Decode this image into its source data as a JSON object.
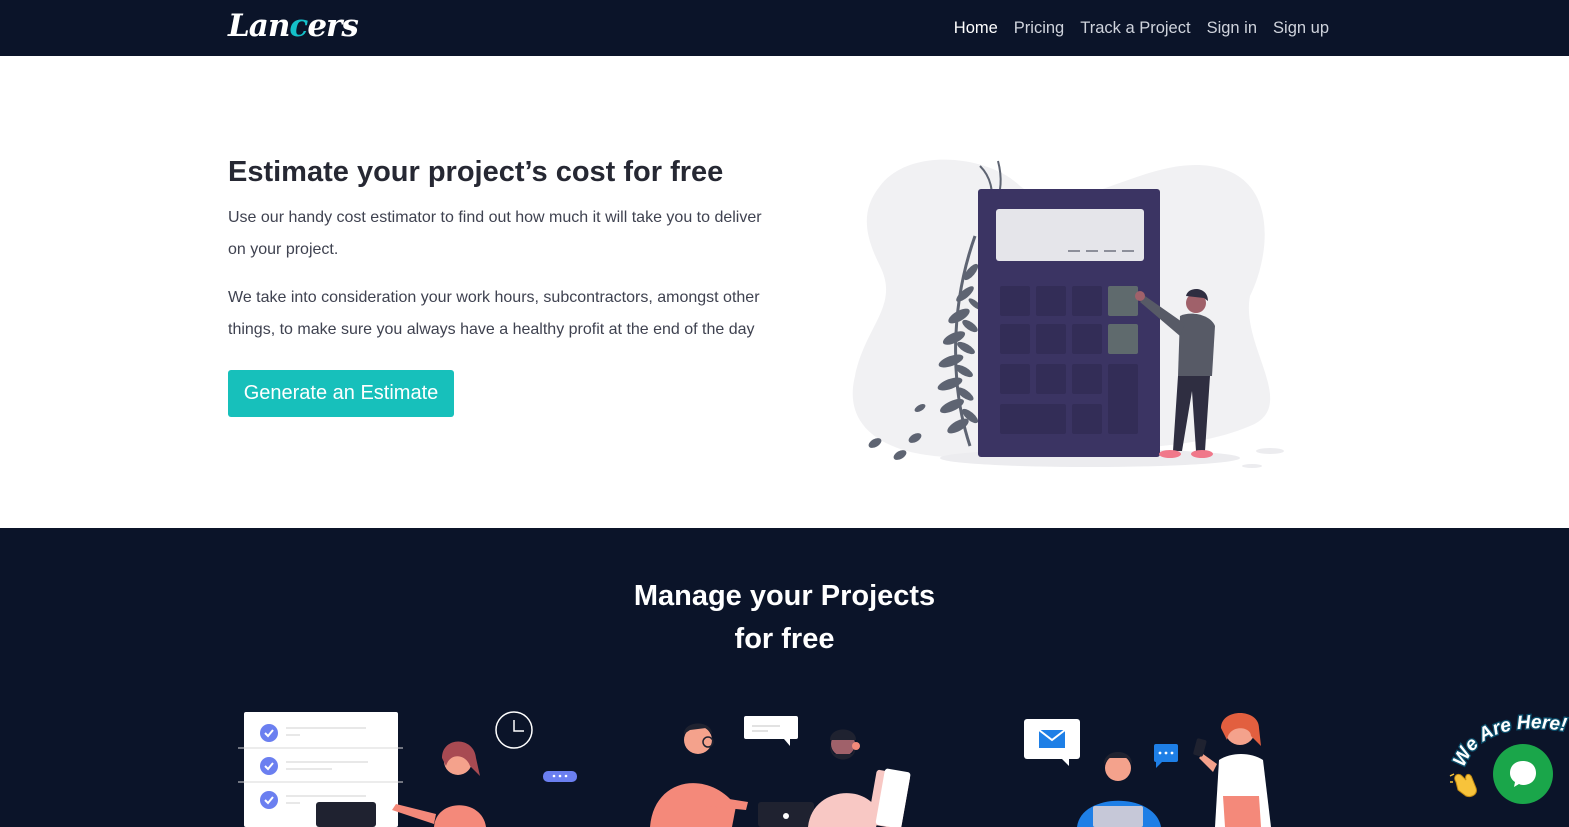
{
  "brand": {
    "logo_text_a": "Lan",
    "logo_text_b": "c",
    "logo_text_c": "ers"
  },
  "nav": {
    "items": [
      {
        "label": "Home",
        "active": true
      },
      {
        "label": "Pricing",
        "active": false
      },
      {
        "label": "Track a Project",
        "active": false
      },
      {
        "label": "Sign in",
        "active": false
      },
      {
        "label": "Sign up",
        "active": false
      }
    ]
  },
  "hero": {
    "title": "Estimate your project’s cost for free",
    "paragraph_1": "Use our handy cost estimator to find out how much it will take you to deliver on your project.",
    "paragraph_2": "We take into consideration your work hours, subcontractors, amongst other things, to make sure you always have a healthy profit at the end of the day",
    "cta_label": "Generate an Estimate",
    "illustration": "calculator-person-illustration"
  },
  "manage": {
    "title_line_1": "Manage your Projects",
    "title_line_2": "for free",
    "features": [
      {
        "illustration": "task-checklist-illustration"
      },
      {
        "illustration": "team-collaboration-illustration"
      },
      {
        "illustration": "client-messaging-illustration"
      }
    ]
  },
  "chat": {
    "label": "We Are Here!",
    "icon": "chat-bubble-icon",
    "wave_icon": "waving-hand-icon"
  },
  "colors": {
    "nav_bg": "#0b1429",
    "accent": "#14c0c9",
    "cta": "#17c0bb",
    "chat": "#1aa64a",
    "calculator": "#3b3463",
    "figure": "#f4897a"
  }
}
